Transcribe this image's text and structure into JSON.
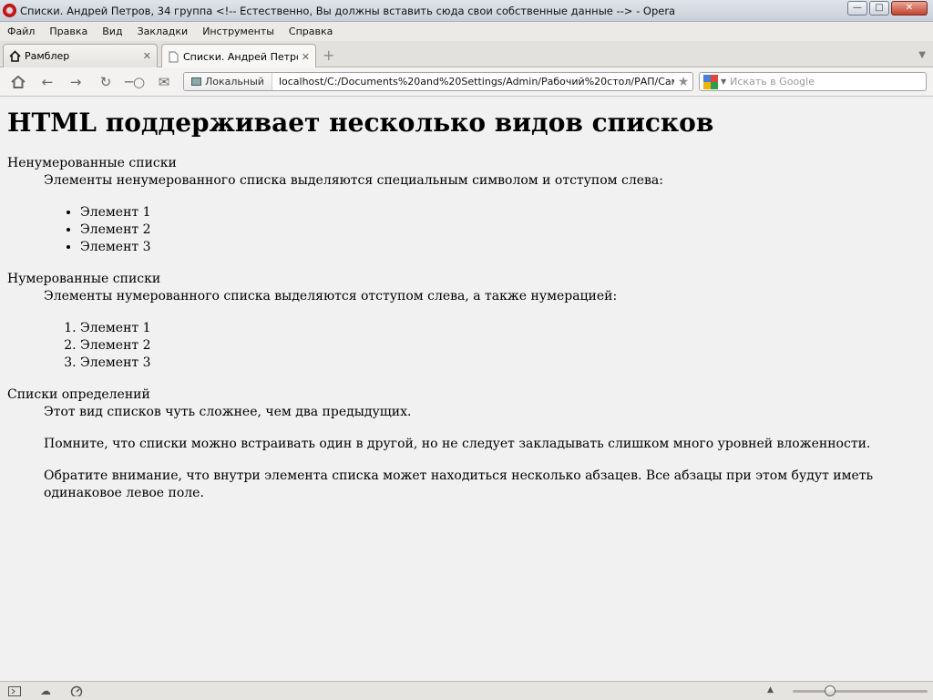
{
  "window": {
    "title": "Списки. Андрей Петров, 34 группа <!-- Естественно, Вы должны вставить сюда свои собственные данные --> - Opera"
  },
  "menu": [
    "Файл",
    "Правка",
    "Вид",
    "Закладки",
    "Инструменты",
    "Справка"
  ],
  "tabs": [
    {
      "label": "Рамблер",
      "active": false
    },
    {
      "label": "Списки. Андрей Петро...",
      "active": true
    }
  ],
  "toolbar": {
    "site_label": "Локальный",
    "url": "localhost/C:/Documents%20and%20Settings/Admin/Рабочий%20стол/РАП/Самостоятельн",
    "search_placeholder": "Искать в Google"
  },
  "page": {
    "heading": "HTML поддерживает несколько видов списков",
    "unordered": {
      "term": "Ненумерованные списки",
      "desc": "Элементы ненумерованного списка выделяются специальным символом и отступом слева:",
      "items": [
        "Элемент 1",
        "Элемент 2",
        "Элемент 3"
      ]
    },
    "ordered": {
      "term": "Нумерованные списки",
      "desc": "Элементы нумерованного списка выделяются отступом слева, а также нумерацией:",
      "items": [
        "Элемент 1",
        "Элемент 2",
        "Элемент 3"
      ]
    },
    "definitions": {
      "term": "Списки определений",
      "paragraphs": [
        "Этот вид списков чуть сложнее, чем два предыдущих.",
        "Помните, что списки можно встраивать один в другой, но не следует закладывать слишком много уровней вложенности.",
        "Обратите внимание, что внутри элемента списка может находиться несколько абзацев. Все абзацы при этом будут иметь одинаковое левое поле."
      ]
    }
  },
  "zoom_level": 0.28
}
